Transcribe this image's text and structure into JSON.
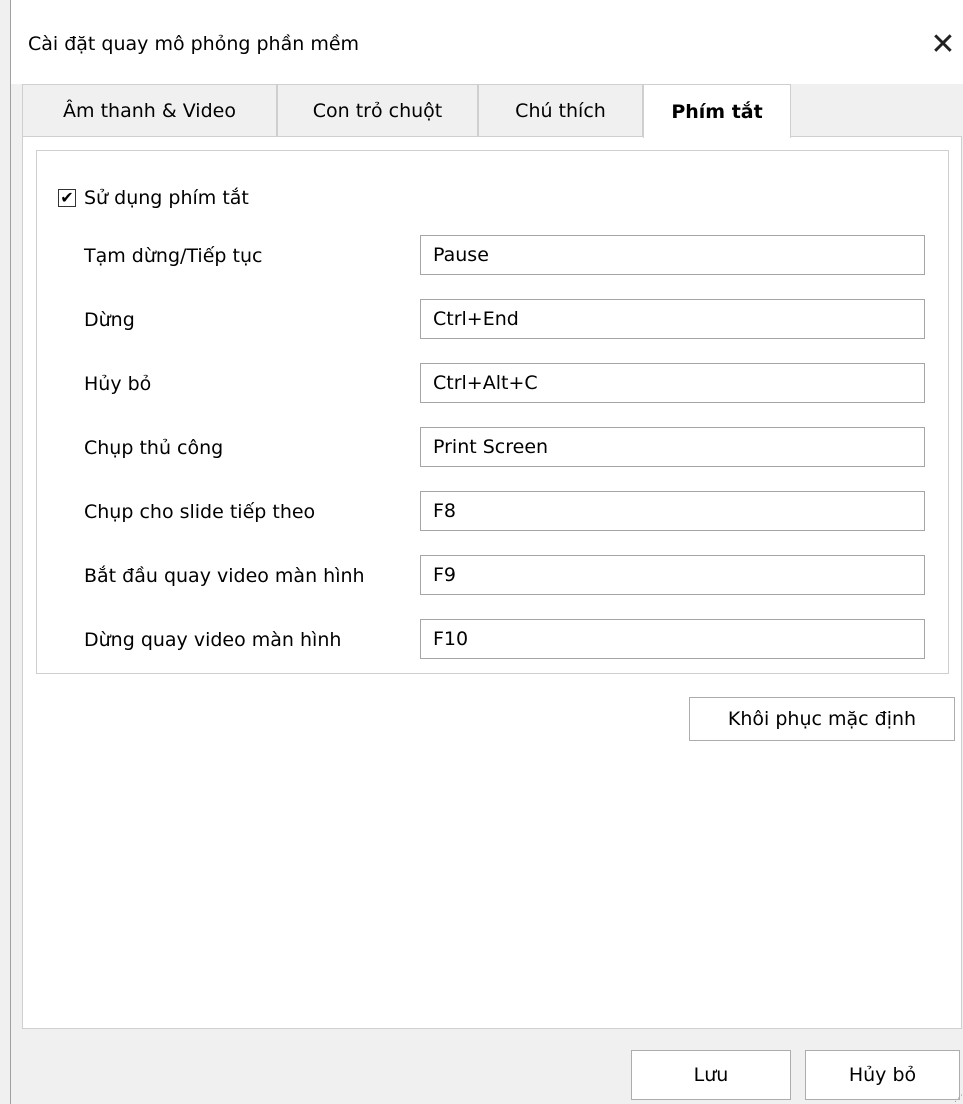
{
  "window": {
    "title": "Cài đặt quay mô phỏng phần mềm",
    "close_icon": "✕"
  },
  "tabs": [
    {
      "label": "Âm thanh & Video",
      "active": false
    },
    {
      "label": "Con trỏ chuột",
      "active": false
    },
    {
      "label": "Chú thích",
      "active": false
    },
    {
      "label": "Phím tắt",
      "active": true
    }
  ],
  "shortcuts": {
    "enable_label": "Sử dụng phím tắt",
    "enable_checked": true,
    "rows": [
      {
        "label": "Tạm dừng/Tiếp tục",
        "value": "Pause"
      },
      {
        "label": "Dừng",
        "value": "Ctrl+End"
      },
      {
        "label": "Hủy bỏ",
        "value": "Ctrl+Alt+C"
      },
      {
        "label": "Chụp thủ công",
        "value": "Print Screen"
      },
      {
        "label": "Chụp cho slide tiếp theo",
        "value": "F8"
      },
      {
        "label": "Bắt đầu quay video màn hình",
        "value": "F9"
      },
      {
        "label": "Dừng quay video màn hình",
        "value": "F10"
      }
    ]
  },
  "restore_label": "Khôi phục mặc định",
  "buttons": {
    "save_label": "Lưu",
    "cancel_label": "Hủy bỏ"
  }
}
